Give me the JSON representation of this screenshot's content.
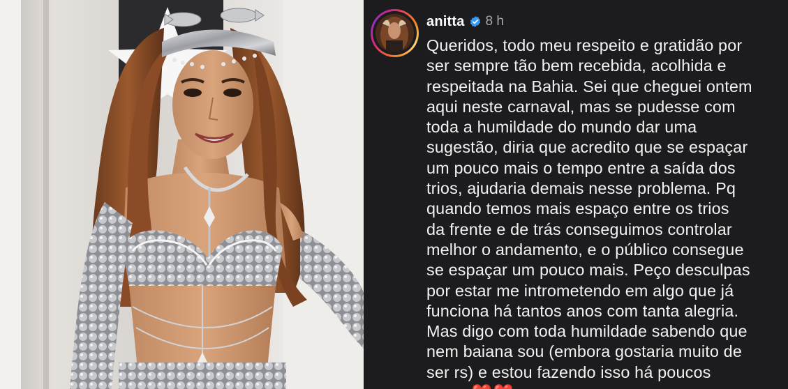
{
  "post": {
    "username": "anitta",
    "verified_icon": "verified-badge-icon",
    "time_ago": "8 h",
    "caption": "Queridos, todo meu respeito e gratidão por\nser sempre tão bem recebida, acolhida e\nrespeitada na Bahia. Sei que cheguei ontem\naqui neste carnaval, mas se pudesse com\ntoda a humildade do mundo dar uma\nsugestão, diria que acredito que se espaçar\num pouco mais o tempo entre a saída dos\ntrios, ajudaria demais nesse problema. Pq\nquando temos mais espaço entre os trios\nda frente e de trás conseguimos controlar\nmelhor o andamento, e o público consegue\nse espaçar um pouco mais. Peço desculpas\npor estar me intrometendo em algo que já\nfunciona há tantos anos com tanta alegria.\nMas digo com toda humildade sabendo que\nnem baiana sou (embora gostaria muito de\nser rs) e estou fazendo isso há poucos\nanos.",
    "hearts": "❤️❤️"
  },
  "colors": {
    "panel_bg": "#1c1c1f",
    "verified_blue": "#3897f0",
    "story_ring": [
      "#d62976",
      "#fa7e1e",
      "#feda75",
      "#962fbf"
    ]
  }
}
